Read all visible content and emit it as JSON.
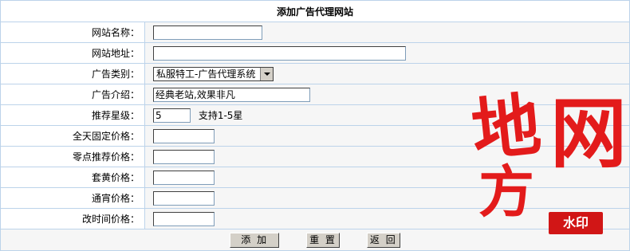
{
  "title": "添加广告代理网站",
  "fields": [
    {
      "label": "网站名称：",
      "value": ""
    },
    {
      "label": "网站地址：",
      "value": ""
    },
    {
      "label": "广告类别：",
      "selected": "私服特工-广告代理系统"
    },
    {
      "label": "广告介绍：",
      "value": "经典老站,效果非凡"
    },
    {
      "label": "推荐星级：",
      "value": "5",
      "note": "支持1-5星"
    },
    {
      "label": "全天固定价格：",
      "value": ""
    },
    {
      "label": "零点推荐价格：",
      "value": ""
    },
    {
      "label": "套黄价格：",
      "value": ""
    },
    {
      "label": "通宵价格：",
      "value": ""
    },
    {
      "label": "改时间价格：",
      "value": ""
    }
  ],
  "buttons": {
    "add": "添 加",
    "reset": "重 置",
    "back": "返 回"
  },
  "watermark": {
    "chars": [
      "地",
      "方",
      "网"
    ],
    "badge": "水印",
    "color": "#e31b1b"
  }
}
